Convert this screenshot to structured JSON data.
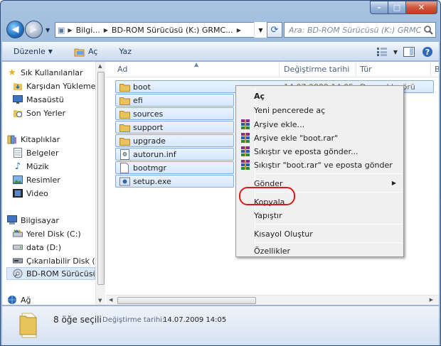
{
  "window": {
    "controls": {
      "minimize": "–",
      "maximize": "□",
      "close": "✕"
    }
  },
  "address": {
    "segments": [
      "Bilgi...",
      "BD-ROM Sürücüsü (K:) GRMC..."
    ],
    "search_placeholder": "Ara: BD-ROM Sürücüsü (K:) GRMCPRF..."
  },
  "toolbar": {
    "organize": "Düzenle",
    "open": "Aç",
    "burn": "Yaz"
  },
  "nav": {
    "items": [
      {
        "label": "Sık Kullanılanlar",
        "icon": "star-icon"
      },
      {
        "label": "Karşıdan Yüklemeler",
        "icon": "downloads-icon"
      },
      {
        "label": "Masaüstü",
        "icon": "desktop-icon"
      },
      {
        "label": "Son Yerler",
        "icon": "recent-places-icon"
      },
      {
        "label": "Kitaplıklar",
        "icon": "libraries-icon"
      },
      {
        "label": "Belgeler",
        "icon": "documents-icon"
      },
      {
        "label": "Müzik",
        "icon": "music-icon"
      },
      {
        "label": "Resimler",
        "icon": "pictures-icon"
      },
      {
        "label": "Video",
        "icon": "video-icon"
      },
      {
        "label": "Bilgisayar",
        "icon": "computer-icon"
      },
      {
        "label": "Yerel Disk (C:)",
        "icon": "local-disk-icon"
      },
      {
        "label": "data (D:)",
        "icon": "drive-icon"
      },
      {
        "label": "Çıkarılabilir Disk (E:)",
        "icon": "removable-disk-icon"
      },
      {
        "label": "BD-ROM Sürücüsü (K:)",
        "icon": "bd-rom-icon"
      },
      {
        "label": "Ağ",
        "icon": "network-icon"
      }
    ]
  },
  "columns": {
    "name": "Ad",
    "date": "Değiştirme tarihi",
    "type": "Tür",
    "size": "B"
  },
  "files": [
    {
      "name": "boot",
      "date": "14.07.2009 14:05",
      "type": "Dosya klasörü",
      "icon": "folder-icon"
    },
    {
      "name": "efi",
      "date": "",
      "type": "",
      "icon": "folder-icon"
    },
    {
      "name": "sources",
      "date": "",
      "type": "",
      "icon": "folder-icon"
    },
    {
      "name": "support",
      "date": "",
      "type": "",
      "icon": "folder-icon"
    },
    {
      "name": "upgrade",
      "date": "",
      "type": "",
      "icon": "folder-icon"
    },
    {
      "name": "autorun.inf",
      "date": "",
      "type": "",
      "icon": "inf-file-icon"
    },
    {
      "name": "bootmgr",
      "date": "",
      "type": "",
      "icon": "file-icon"
    },
    {
      "name": "setup.exe",
      "date": "",
      "type": "",
      "icon": "setup-exe-icon"
    }
  ],
  "context_menu": {
    "items": [
      {
        "label": "Aç",
        "bold": true
      },
      {
        "label": "Yeni pencerede aç"
      },
      {
        "label": "Arşive ekle...",
        "icon": "winrar-icon"
      },
      {
        "label": "Arşive ekle \"boot.rar\"",
        "icon": "winrar-icon"
      },
      {
        "label": "Sıkıştır ve eposta gönder...",
        "icon": "winrar-icon"
      },
      {
        "label": "Sıkıştır \"boot.rar\" ve eposta gönder",
        "icon": "winrar-icon"
      },
      {
        "label": "Gönder",
        "submenu": true
      },
      {
        "label": "Kopyala"
      },
      {
        "label": "Yapıştır"
      },
      {
        "label": "Kısayol Oluştur"
      },
      {
        "label": "Özellikler"
      }
    ]
  },
  "status": {
    "count": "8 öğe seçili",
    "date_label": "Değiştirme tarihi:",
    "date_value": "14.07.2009 14:05"
  },
  "colors": {
    "selection": "#d5e7fc",
    "highlight_oval": "#d91a1a",
    "folder": "#e8c25a"
  }
}
